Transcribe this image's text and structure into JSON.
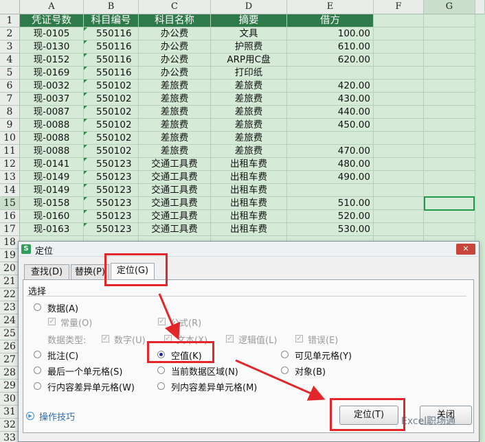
{
  "columns": [
    "A",
    "B",
    "C",
    "D",
    "E",
    "F",
    "G"
  ],
  "rows": [
    "1",
    "2",
    "3",
    "4",
    "5",
    "6",
    "7",
    "8",
    "9",
    "10",
    "11",
    "12",
    "13",
    "14",
    "15",
    "16",
    "17",
    "18",
    "19",
    "20",
    "21",
    "22",
    "23",
    "24",
    "25",
    "26",
    "27",
    "28",
    "29",
    "30",
    "31",
    "32",
    "33"
  ],
  "table": {
    "headers": [
      "凭证号数",
      "科目编号",
      "科目名称",
      "摘要",
      "借方"
    ],
    "rows": [
      [
        "现-0105",
        "550116",
        "办公费",
        "文具",
        "100.00"
      ],
      [
        "现-0130",
        "550116",
        "办公费",
        "护照费",
        "610.00"
      ],
      [
        "现-0152",
        "550116",
        "办公费",
        "ARP用C盘",
        "620.00"
      ],
      [
        "现-0169",
        "550116",
        "办公费",
        "打印纸",
        ""
      ],
      [
        "现-0032",
        "550102",
        "差旅费",
        "差旅费",
        "420.00"
      ],
      [
        "现-0037",
        "550102",
        "差旅费",
        "差旅费",
        "430.00"
      ],
      [
        "现-0087",
        "550102",
        "差旅费",
        "差旅费",
        "440.00"
      ],
      [
        "现-0088",
        "550102",
        "差旅费",
        "差旅费",
        "450.00"
      ],
      [
        "现-0088",
        "550102",
        "差旅费",
        "差旅费",
        ""
      ],
      [
        "现-0088",
        "550102",
        "差旅费",
        "差旅费",
        "470.00"
      ],
      [
        "现-0141",
        "550123",
        "交通工具费",
        "出租车费",
        "480.00"
      ],
      [
        "现-0149",
        "550123",
        "交通工具费",
        "出租车费",
        "490.00"
      ],
      [
        "现-0149",
        "550123",
        "交通工具费",
        "出租车费",
        ""
      ],
      [
        "现-0158",
        "550123",
        "交通工具费",
        "出租车费",
        "510.00"
      ],
      [
        "现-0160",
        "550123",
        "交通工具费",
        "出租车费",
        "520.00"
      ],
      [
        "现-0163",
        "550123",
        "交通工具费",
        "出租车费",
        "530.00"
      ]
    ]
  },
  "dialog": {
    "app_icon": "S",
    "title": "定位",
    "close": "✕",
    "tabs": [
      "查找(D)",
      "替换(P)",
      "定位(G)"
    ],
    "active_tab": "定位(G)",
    "group_label": "选择",
    "options": {
      "data": "数据(A)",
      "constant": "常量(O)",
      "formula": "公式(R)",
      "data_type_label": "数据类型:",
      "number": "数字(U)",
      "text": "文本(X)",
      "logical": "逻辑值(L)",
      "error": "错误(E)",
      "comment": "批注(C)",
      "blank": "空值(K)",
      "visible": "可见单元格(Y)",
      "last_cell": "最后一个单元格(S)",
      "current_region": "当前数据区域(N)",
      "objects": "对象(B)",
      "row_diff": "行内容差异单元格(W)",
      "col_diff": "列内容差异单元格(M)"
    },
    "selected_option": "空值(K)",
    "tips_link": "操作技巧",
    "goto_button": "定位(T)",
    "close_button": "关闭"
  },
  "colors": {
    "header_green": "#2f7a49",
    "annotation_red": "#e3262a"
  },
  "watermark": "Excel职场通"
}
